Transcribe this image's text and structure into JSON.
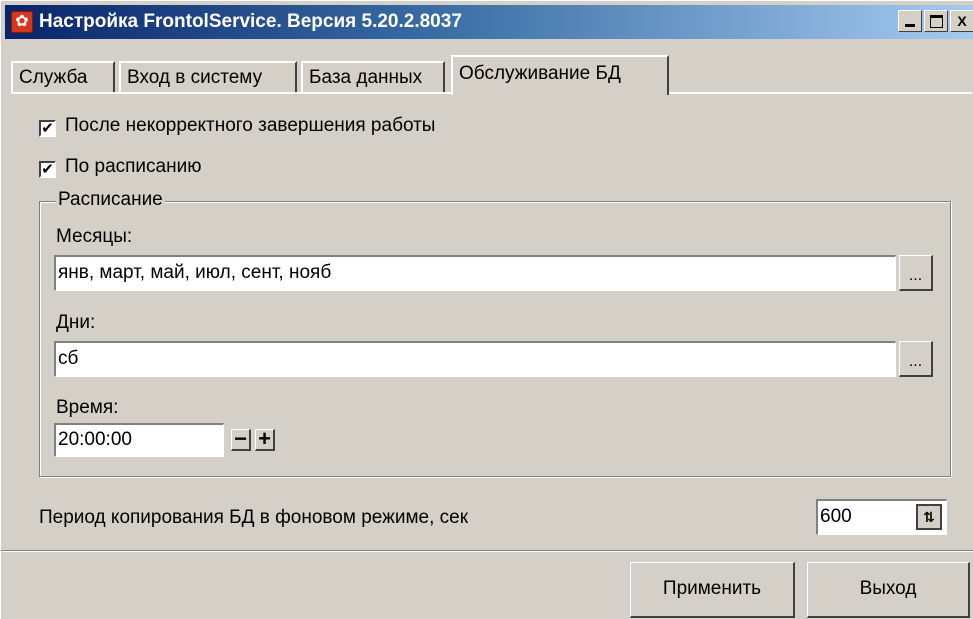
{
  "window": {
    "title": "Настройка FrontolService. Версия 5.20.2.8037",
    "icon": "gear-icon"
  },
  "title_buttons": {
    "minimize": "minimize-icon",
    "maximize": "maximize-icon",
    "close": "X"
  },
  "tabs": [
    {
      "label": "Служба"
    },
    {
      "label": "Вход в систему"
    },
    {
      "label": "База данных"
    },
    {
      "label": "Обслуживание БД",
      "active": true
    }
  ],
  "options": {
    "after_crash": {
      "label": "После некорректного завершения работы",
      "checked": true
    },
    "by_schedule": {
      "label": "По расписанию",
      "checked": true
    }
  },
  "schedule": {
    "legend": "Расписание",
    "months_label": "Месяцы:",
    "months_value": "янв, март, май, июл, сент, нояб",
    "days_label": "Дни:",
    "days_value": "сб",
    "time_label": "Время:",
    "time_value": "20:00:00",
    "browse_label": "...",
    "minus_label": "−",
    "plus_label": "+"
  },
  "backup": {
    "label": "Период копирования БД в фоновом режиме, сек",
    "value": "600"
  },
  "buttons": {
    "apply": "Применить",
    "exit": "Выход"
  }
}
